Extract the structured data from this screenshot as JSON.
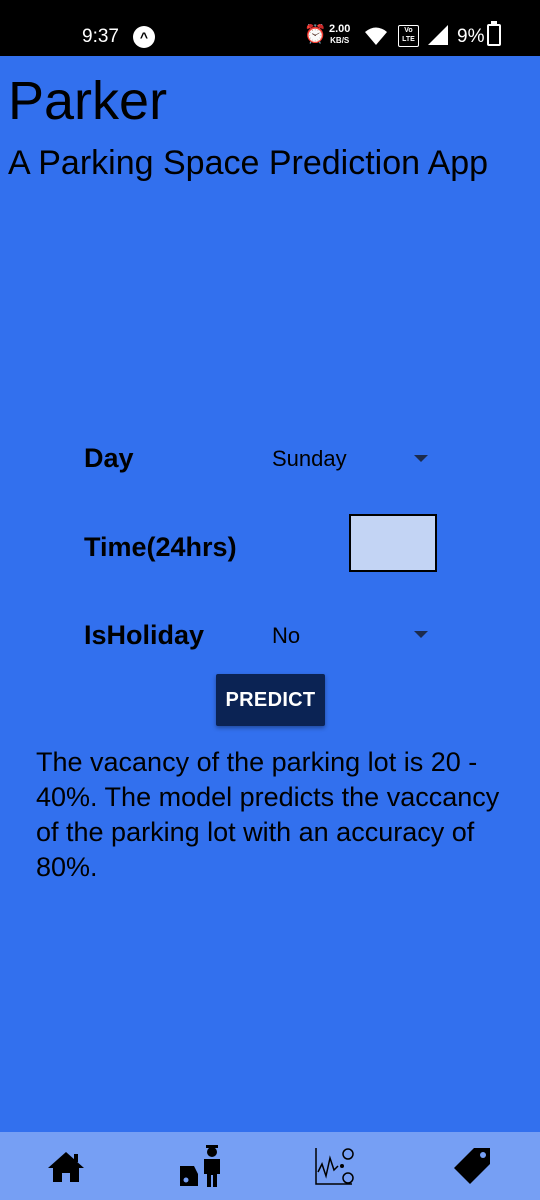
{
  "status_bar": {
    "time": "9:37",
    "speed_value": "2.00",
    "speed_unit": "KB/S",
    "volte_label": "Vo LTE",
    "battery": "9%"
  },
  "header": {
    "title": "Parker",
    "subtitle": "A Parking Space Prediction App"
  },
  "form": {
    "day_label": "Day",
    "day_value": "Sunday",
    "time_label": "Time(24hrs)",
    "time_value": "",
    "holiday_label": "IsHoliday",
    "holiday_value": "No",
    "predict_label": "PREDICT"
  },
  "result": {
    "text": "The vacancy of the parking lot is 20 - 40%. The model predicts the vaccancy of the parking lot with an accuracy of 80%."
  },
  "bottom_nav": {
    "items": [
      {
        "icon": "home-icon"
      },
      {
        "icon": "valet-parking-icon"
      },
      {
        "icon": "analytics-icon"
      },
      {
        "icon": "tag-icon"
      }
    ]
  },
  "colors": {
    "background": "#3270ee",
    "nav_background": "#769ff4",
    "button": "#0b2354",
    "input": "#c3d4f4"
  }
}
